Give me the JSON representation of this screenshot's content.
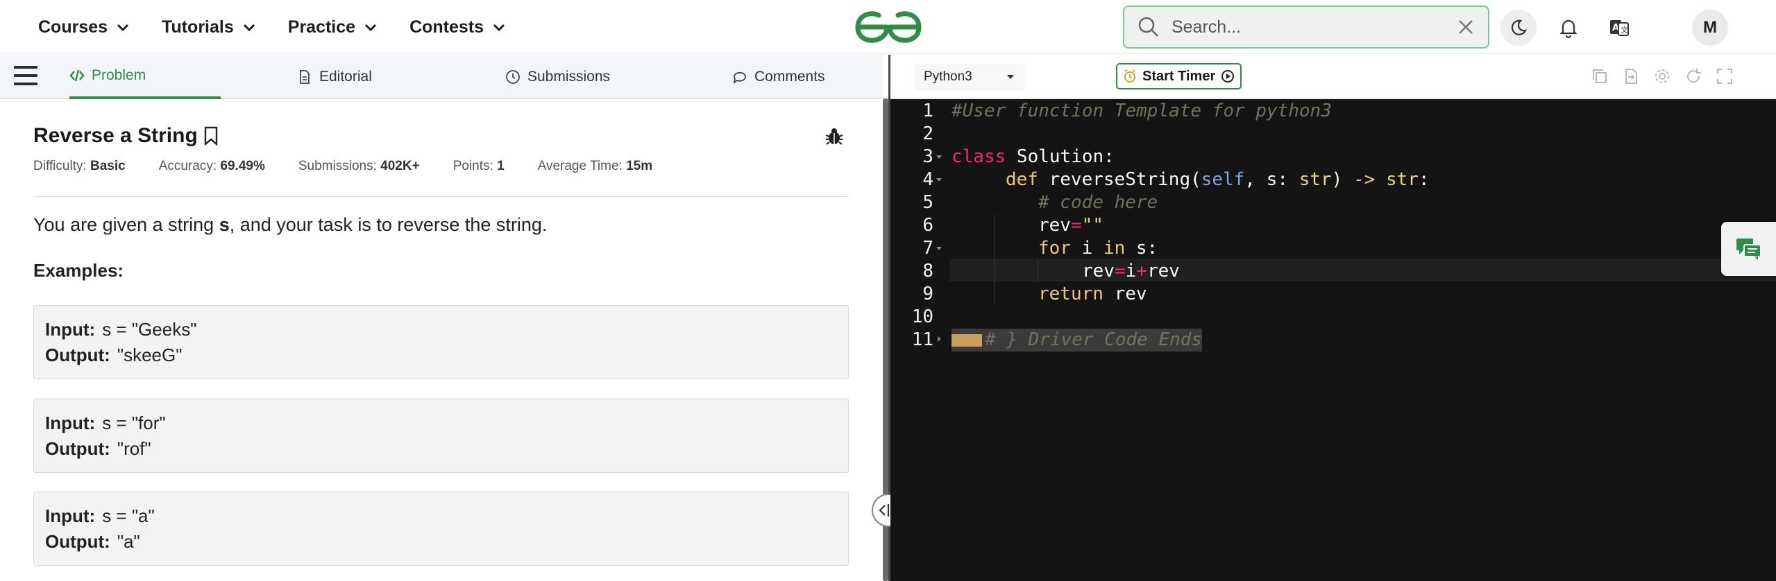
{
  "nav": {
    "items": [
      {
        "label": "Courses"
      },
      {
        "label": "Tutorials"
      },
      {
        "label": "Practice"
      },
      {
        "label": "Contests"
      }
    ],
    "search_placeholder": "Search...",
    "avatar_initial": "M",
    "brand_color": "#2f8d46"
  },
  "tabs": {
    "problem": "Problem",
    "editorial": "Editorial",
    "submissions": "Submissions",
    "comments": "Comments"
  },
  "problem": {
    "title": "Reverse a String",
    "meta": {
      "difficulty_label": "Difficulty:",
      "difficulty": "Basic",
      "accuracy_label": "Accuracy:",
      "accuracy": "69.49%",
      "submissions_label": "Submissions:",
      "submissions": "402K+",
      "points_label": "Points:",
      "points": "1",
      "avg_time_label": "Average Time:",
      "avg_time": "15m"
    },
    "statement_pre": "You are given a string ",
    "statement_var": "s",
    "statement_post": ", and your task is to reverse the string.",
    "examples_label": "Examples:",
    "examples": [
      {
        "input_label": "Input:",
        "input": "s = \"Geeks\"",
        "output_label": "Output:",
        "output": "\"skeeG\""
      },
      {
        "input_label": "Input:",
        "input": "s = \"for\"",
        "output_label": "Output:",
        "output": "\"rof\""
      },
      {
        "input_label": "Input:",
        "input": "s = \"a\"",
        "output_label": "Output:",
        "output": "\"a\""
      }
    ]
  },
  "editor": {
    "language": "Python3",
    "timer_label": "Start Timer",
    "line_numbers": [
      "1",
      "2",
      "3",
      "4",
      "5",
      "6",
      "7",
      "8",
      "9",
      "10",
      "11"
    ],
    "code": {
      "l1": "#User function Template for python3",
      "l3_kw": "class",
      "l3_rest": " Solution:",
      "l4_kw": "def",
      "l4_name": " reverseString(",
      "l4_self": "self",
      "l4_mid": ", s: ",
      "l4_type1": "str",
      "l4_close": ") ",
      "l4_arrow": "->",
      "l4_sp": " ",
      "l4_type2": "str",
      "l4_colon": ":",
      "l5": "# code here",
      "l6_var": "rev",
      "l6_eq": "=",
      "l6_str": "\"\"",
      "l7_kw": "for",
      "l7_mid": " i ",
      "l7_in": "in",
      "l7_rest": " s:",
      "l8_a": "rev",
      "l8_eq": "=",
      "l8_b": "i",
      "l8_plus": "+",
      "l8_c": "rev",
      "l9_kw": "return",
      "l9_rest": " rev",
      "l11": "# } Driver Code Ends"
    },
    "colors": {
      "background": "#141414",
      "keyword": "#f92672",
      "string": "#e6db74",
      "comment": "#75715e"
    }
  }
}
